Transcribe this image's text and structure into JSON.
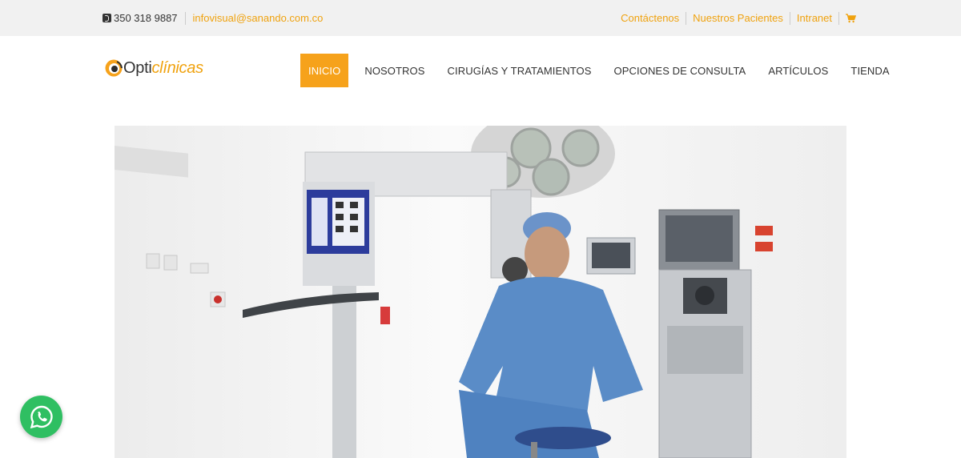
{
  "topbar": {
    "phone": "350 318 9887",
    "email": "infovisual@sanando.com.co",
    "links": [
      "Contáctenos",
      "Nuestros Pacientes",
      "Intranet"
    ],
    "cart_icon": "shopping-cart-icon"
  },
  "brand": {
    "logo_prefix": "Opti",
    "logo_suffix": "clínicas",
    "accent_color": "#f6a21b"
  },
  "nav": {
    "items": [
      "INICIO",
      "NOSOTROS",
      "CIRUGÍAS Y TRATAMIENTOS",
      "OPCIONES DE CONSULTA",
      "ARTÍCULOS",
      "TIENDA"
    ],
    "active": "INICIO"
  },
  "floating": {
    "whatsapp_icon": "whatsapp-icon",
    "whatsapp_color": "#2fbf62"
  }
}
